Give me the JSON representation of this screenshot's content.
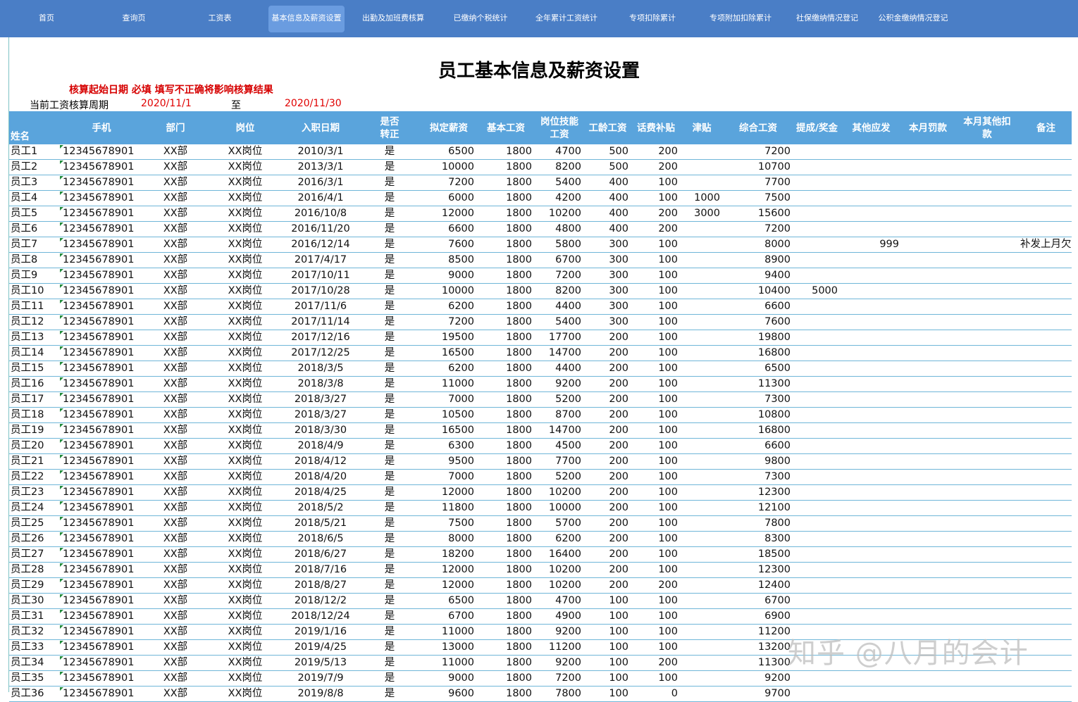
{
  "nav": {
    "items": [
      {
        "label": "首页"
      },
      {
        "label": "查询页"
      },
      {
        "label": "工资表"
      },
      {
        "label": "基本信息及薪资设置"
      },
      {
        "label": "出勤及加班费核算"
      },
      {
        "label": "已缴纳个税统计"
      },
      {
        "label": "全年累计工资统计"
      },
      {
        "label": "专项扣除累计"
      },
      {
        "label": "专项附加扣除累计"
      },
      {
        "label": "社保缴纳情况登记"
      },
      {
        "label": "公积金缴纳情况登记"
      }
    ],
    "active_index": 3
  },
  "page": {
    "title": "员工基本信息及薪资设置",
    "notice": "核算起始日期 必填 填写不正确将影响核算结果",
    "period_label": "当前工资核算周期",
    "period_start": "2020/11/1",
    "period_to": "至",
    "period_end": "2020/11/30"
  },
  "table": {
    "headers": [
      "姓名",
      "手机",
      "部门",
      "岗位",
      "入职日期",
      "是否\n转正",
      "拟定薪资",
      "基本工资",
      "岗位技能\n工资",
      "工龄工资",
      "话费补贴",
      "津贴",
      "综合工资",
      "提成/奖金",
      "其他应发",
      "本月罚款",
      "本月其他扣\n款",
      "备注"
    ],
    "rows": [
      [
        "员工1",
        "12345678901",
        "XX部",
        "XX岗位",
        "2010/3/1",
        "是",
        "6500",
        "1800",
        "4700",
        "500",
        "200",
        "",
        "7200",
        "",
        "",
        "",
        "",
        ""
      ],
      [
        "员工2",
        "12345678901",
        "XX部",
        "XX岗位",
        "2013/3/1",
        "是",
        "10000",
        "1800",
        "8200",
        "500",
        "200",
        "",
        "10700",
        "",
        "",
        "",
        "",
        ""
      ],
      [
        "员工3",
        "12345678901",
        "XX部",
        "XX岗位",
        "2016/3/1",
        "是",
        "7200",
        "1800",
        "5400",
        "400",
        "100",
        "",
        "7700",
        "",
        "",
        "",
        "",
        ""
      ],
      [
        "员工4",
        "12345678901",
        "XX部",
        "XX岗位",
        "2016/4/1",
        "是",
        "6000",
        "1800",
        "4200",
        "400",
        "100",
        "1000",
        "7500",
        "",
        "",
        "",
        "",
        ""
      ],
      [
        "员工5",
        "12345678901",
        "XX部",
        "XX岗位",
        "2016/10/8",
        "是",
        "12000",
        "1800",
        "10200",
        "400",
        "200",
        "3000",
        "15600",
        "",
        "",
        "",
        "",
        ""
      ],
      [
        "员工6",
        "12345678901",
        "XX部",
        "XX岗位",
        "2016/11/20",
        "是",
        "6600",
        "1800",
        "4800",
        "400",
        "200",
        "",
        "7200",
        "",
        "",
        "",
        "",
        ""
      ],
      [
        "员工7",
        "12345678901",
        "XX部",
        "XX岗位",
        "2016/12/14",
        "是",
        "7600",
        "1800",
        "5800",
        "300",
        "100",
        "",
        "8000",
        "",
        "999",
        "",
        "",
        "补发上月欠款"
      ],
      [
        "员工8",
        "12345678901",
        "XX部",
        "XX岗位",
        "2017/4/17",
        "是",
        "8500",
        "1800",
        "6700",
        "300",
        "100",
        "",
        "8900",
        "",
        "",
        "",
        "",
        ""
      ],
      [
        "员工9",
        "12345678901",
        "XX部",
        "XX岗位",
        "2017/10/11",
        "是",
        "9000",
        "1800",
        "7200",
        "300",
        "100",
        "",
        "9400",
        "",
        "",
        "",
        "",
        ""
      ],
      [
        "员工10",
        "12345678901",
        "XX部",
        "XX岗位",
        "2017/10/28",
        "是",
        "10000",
        "1800",
        "8200",
        "300",
        "100",
        "",
        "10400",
        "5000",
        "",
        "",
        "",
        ""
      ],
      [
        "员工11",
        "12345678901",
        "XX部",
        "XX岗位",
        "2017/11/6",
        "是",
        "6200",
        "1800",
        "4400",
        "300",
        "100",
        "",
        "6600",
        "",
        "",
        "",
        "",
        ""
      ],
      [
        "员工12",
        "12345678901",
        "XX部",
        "XX岗位",
        "2017/11/14",
        "是",
        "7200",
        "1800",
        "5400",
        "300",
        "100",
        "",
        "7600",
        "",
        "",
        "",
        "",
        ""
      ],
      [
        "员工13",
        "12345678901",
        "XX部",
        "XX岗位",
        "2017/12/16",
        "是",
        "19500",
        "1800",
        "17700",
        "200",
        "100",
        "",
        "19800",
        "",
        "",
        "",
        "",
        ""
      ],
      [
        "员工14",
        "12345678901",
        "XX部",
        "XX岗位",
        "2017/12/25",
        "是",
        "16500",
        "1800",
        "14700",
        "200",
        "100",
        "",
        "16800",
        "",
        "",
        "",
        "",
        ""
      ],
      [
        "员工15",
        "12345678901",
        "XX部",
        "XX岗位",
        "2018/3/5",
        "是",
        "6200",
        "1800",
        "4400",
        "200",
        "100",
        "",
        "6500",
        "",
        "",
        "",
        "",
        ""
      ],
      [
        "员工16",
        "12345678901",
        "XX部",
        "XX岗位",
        "2018/3/8",
        "是",
        "11000",
        "1800",
        "9200",
        "200",
        "100",
        "",
        "11300",
        "",
        "",
        "",
        "",
        ""
      ],
      [
        "员工17",
        "12345678901",
        "XX部",
        "XX岗位",
        "2018/3/27",
        "是",
        "7000",
        "1800",
        "5200",
        "200",
        "100",
        "",
        "7300",
        "",
        "",
        "",
        "",
        ""
      ],
      [
        "员工18",
        "12345678901",
        "XX部",
        "XX岗位",
        "2018/3/27",
        "是",
        "10500",
        "1800",
        "8700",
        "200",
        "100",
        "",
        "10800",
        "",
        "",
        "",
        "",
        ""
      ],
      [
        "员工19",
        "12345678901",
        "XX部",
        "XX岗位",
        "2018/3/30",
        "是",
        "16500",
        "1800",
        "14700",
        "200",
        "100",
        "",
        "16800",
        "",
        "",
        "",
        "",
        ""
      ],
      [
        "员工20",
        "12345678901",
        "XX部",
        "XX岗位",
        "2018/4/9",
        "是",
        "6300",
        "1800",
        "4500",
        "200",
        "100",
        "",
        "6600",
        "",
        "",
        "",
        "",
        ""
      ],
      [
        "员工21",
        "12345678901",
        "XX部",
        "XX岗位",
        "2018/4/12",
        "是",
        "9500",
        "1800",
        "7700",
        "200",
        "100",
        "",
        "9800",
        "",
        "",
        "",
        "",
        ""
      ],
      [
        "员工22",
        "12345678901",
        "XX部",
        "XX岗位",
        "2018/4/20",
        "是",
        "7000",
        "1800",
        "5200",
        "200",
        "100",
        "",
        "7300",
        "",
        "",
        "",
        "",
        ""
      ],
      [
        "员工23",
        "12345678901",
        "XX部",
        "XX岗位",
        "2018/4/25",
        "是",
        "12000",
        "1800",
        "10200",
        "200",
        "100",
        "",
        "12300",
        "",
        "",
        "",
        "",
        ""
      ],
      [
        "员工24",
        "12345678901",
        "XX部",
        "XX岗位",
        "2018/5/2",
        "是",
        "11800",
        "1800",
        "10000",
        "200",
        "100",
        "",
        "12100",
        "",
        "",
        "",
        "",
        ""
      ],
      [
        "员工25",
        "12345678901",
        "XX部",
        "XX岗位",
        "2018/5/21",
        "是",
        "7500",
        "1800",
        "5700",
        "200",
        "100",
        "",
        "7800",
        "",
        "",
        "",
        "",
        ""
      ],
      [
        "员工26",
        "12345678901",
        "XX部",
        "XX岗位",
        "2018/6/5",
        "是",
        "8000",
        "1800",
        "6200",
        "200",
        "100",
        "",
        "8300",
        "",
        "",
        "",
        "",
        ""
      ],
      [
        "员工27",
        "12345678901",
        "XX部",
        "XX岗位",
        "2018/6/27",
        "是",
        "18200",
        "1800",
        "16400",
        "200",
        "100",
        "",
        "18500",
        "",
        "",
        "",
        "",
        ""
      ],
      [
        "员工28",
        "12345678901",
        "XX部",
        "XX岗位",
        "2018/7/16",
        "是",
        "12000",
        "1800",
        "10200",
        "200",
        "100",
        "",
        "12300",
        "",
        "",
        "",
        "",
        ""
      ],
      [
        "员工29",
        "12345678901",
        "XX部",
        "XX岗位",
        "2018/8/27",
        "是",
        "12000",
        "1800",
        "10200",
        "200",
        "200",
        "",
        "12400",
        "",
        "",
        "",
        "",
        ""
      ],
      [
        "员工30",
        "12345678901",
        "XX部",
        "XX岗位",
        "2018/12/2",
        "是",
        "6500",
        "1800",
        "4700",
        "100",
        "100",
        "",
        "6700",
        "",
        "",
        "",
        "",
        ""
      ],
      [
        "员工31",
        "12345678901",
        "XX部",
        "XX岗位",
        "2018/12/24",
        "是",
        "6700",
        "1800",
        "4900",
        "100",
        "100",
        "",
        "6900",
        "",
        "",
        "",
        "",
        ""
      ],
      [
        "员工32",
        "12345678901",
        "XX部",
        "XX岗位",
        "2019/1/16",
        "是",
        "11000",
        "1800",
        "9200",
        "100",
        "100",
        "",
        "11200",
        "",
        "",
        "",
        "",
        ""
      ],
      [
        "员工33",
        "12345678901",
        "XX部",
        "XX岗位",
        "2019/4/25",
        "是",
        "13000",
        "1800",
        "11200",
        "100",
        "100",
        "",
        "13200",
        "",
        "",
        "",
        "",
        ""
      ],
      [
        "员工34",
        "12345678901",
        "XX部",
        "XX岗位",
        "2019/5/13",
        "是",
        "11000",
        "1800",
        "9200",
        "100",
        "200",
        "",
        "11300",
        "",
        "",
        "",
        "",
        ""
      ],
      [
        "员工35",
        "12345678901",
        "XX部",
        "XX岗位",
        "2019/7/9",
        "是",
        "9000",
        "1800",
        "7200",
        "100",
        "100",
        "",
        "9200",
        "",
        "",
        "",
        "",
        ""
      ],
      [
        "员工36",
        "12345678901",
        "XX部",
        "XX岗位",
        "2019/8/8",
        "是",
        "9600",
        "1800",
        "7800",
        "100",
        "0",
        "",
        "9700",
        "",
        "",
        "",
        "",
        ""
      ]
    ]
  },
  "watermark": "知乎 @八月的会计",
  "colors": {
    "nav_bg": "#4a7ec6",
    "nav_active": "#6a9ce0",
    "header_bg": "#5aa4dc",
    "row_line": "#6fb6d8",
    "notice": "#d60000",
    "date_red": "#e00000"
  }
}
